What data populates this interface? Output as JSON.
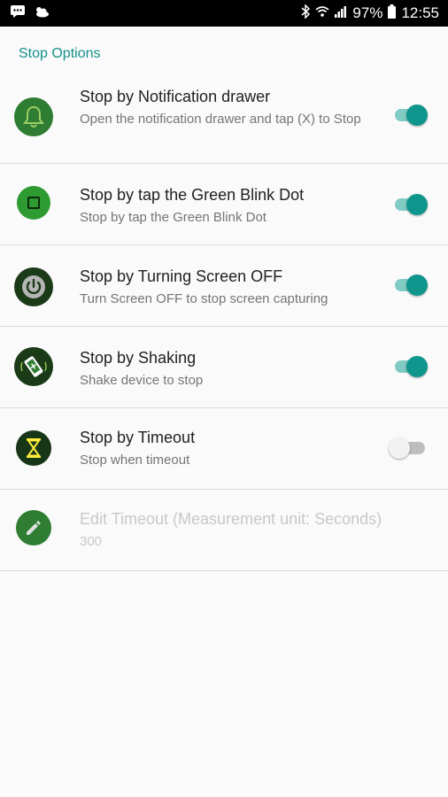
{
  "status_bar": {
    "battery_percent": "97%",
    "time": "12:55",
    "icons": [
      "message-icon",
      "weather-cloud-icon",
      "bluetooth-icon",
      "wifi-icon",
      "signal-icon",
      "battery-icon"
    ]
  },
  "section": {
    "header": "Stop Options"
  },
  "options": [
    {
      "title": "Stop by Notification drawer",
      "summary": "Open the notification drawer and tap (X) to Stop",
      "icon": "bell-icon",
      "enabled": true,
      "checked": true
    },
    {
      "title": "Stop by tap the Green Blink Dot",
      "summary": "Stop by tap the Green Blink Dot",
      "icon": "green-dot-icon",
      "enabled": true,
      "checked": true
    },
    {
      "title": "Stop by Turning Screen OFF",
      "summary": "Turn Screen OFF to stop screen capturing",
      "icon": "power-icon",
      "enabled": true,
      "checked": true
    },
    {
      "title": "Stop by Shaking",
      "summary": "Shake device to stop",
      "icon": "shake-phone-icon",
      "enabled": true,
      "checked": true
    },
    {
      "title": "Stop by Timeout",
      "summary": "Stop when timeout",
      "icon": "hourglass-icon",
      "enabled": true,
      "checked": false
    },
    {
      "title": "Edit Timeout (Measurement unit: Seconds)",
      "summary": "300",
      "icon": "pencil-icon",
      "enabled": false
    }
  ],
  "colors": {
    "accent": "#0f968c",
    "header": "#14908a",
    "icon_green": "#2e7d32",
    "icon_dark": "#1b3a18"
  }
}
